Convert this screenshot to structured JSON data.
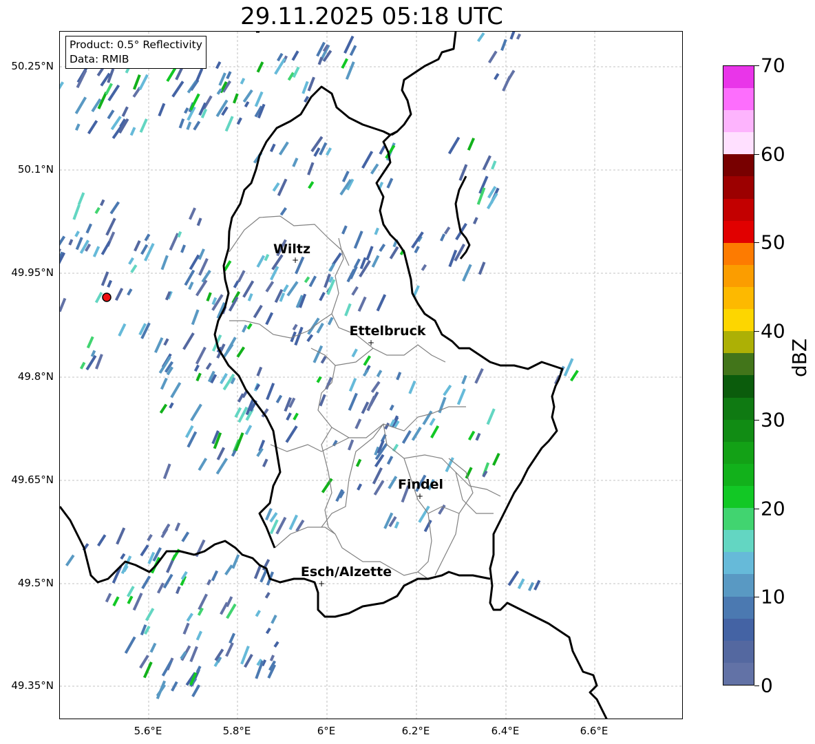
{
  "title": "29.11.2025 05:18 UTC",
  "info": {
    "line1": "Product: 0.5° Reflectivity",
    "line2": "Data: RMIB"
  },
  "lat_ticks": [
    "50.25°N",
    "50.1°N",
    "49.95°N",
    "49.8°N",
    "49.65°N",
    "49.5°N",
    "49.35°N"
  ],
  "lon_ticks": [
    "5.6°E",
    "5.8°E",
    "6°E",
    "6.2°E",
    "6.4°E",
    "6.6°E"
  ],
  "cities": [
    "Wiltz",
    "Ettelbruck",
    "Findel",
    "Esch/Alzette"
  ],
  "radar_site": "radar-site-marker",
  "colorbar": {
    "unit": "dBZ",
    "labels": [
      "0",
      "10",
      "20",
      "30",
      "40",
      "50",
      "60",
      "70"
    ],
    "colors": [
      "#6272a6",
      "#5468a0",
      "#4463a4",
      "#4b79b1",
      "#5999c3",
      "#66bad9",
      "#63d6c2",
      "#41d470",
      "#12c825",
      "#12b11b",
      "#13a116",
      "#118c14",
      "#0f7a12",
      "#0b5c0c",
      "#42751a",
      "#adb005",
      "#fdd600",
      "#fdb900",
      "#fb9d00",
      "#fd7b01",
      "#e10000",
      "#c30000",
      "#9c0000",
      "#780000",
      "#ffe0ff",
      "#fdb4fd",
      "#fd6efd",
      "#e935e9"
    ]
  }
}
